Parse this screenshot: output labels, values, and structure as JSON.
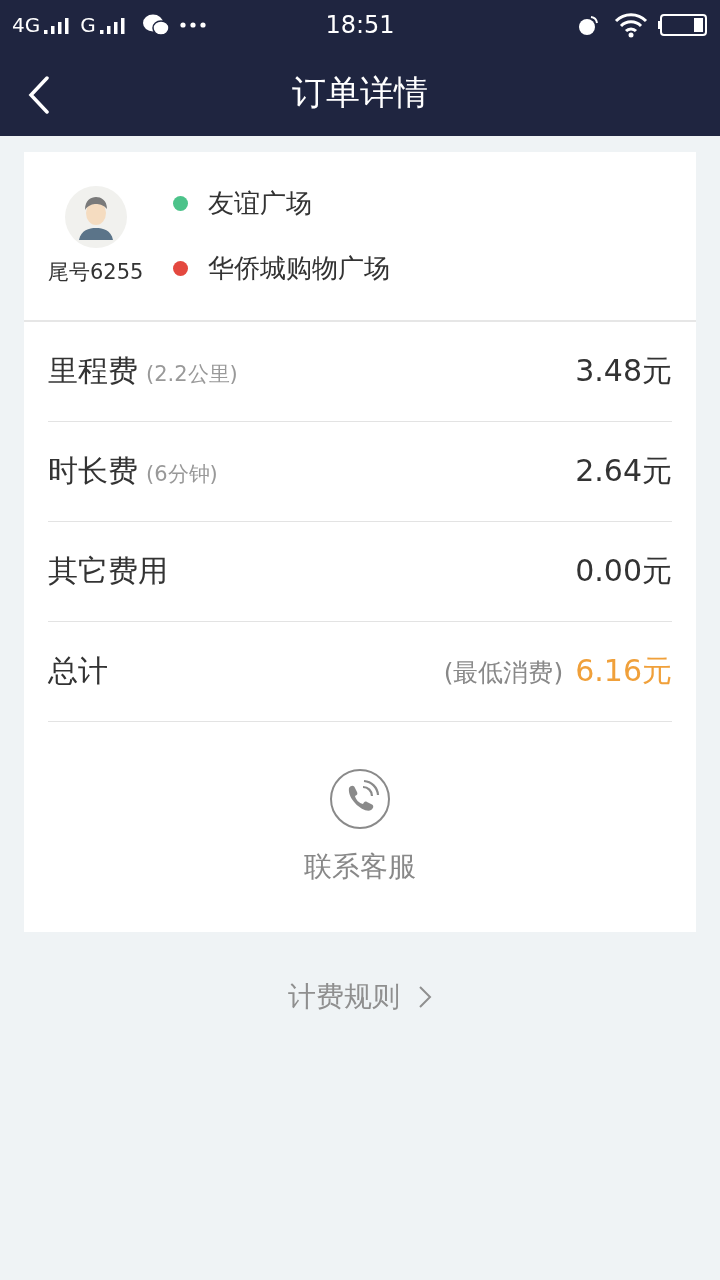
{
  "status_bar": {
    "network_1": "4G",
    "network_2": "G",
    "time": "18:51"
  },
  "nav": {
    "title": "订单详情"
  },
  "trip": {
    "driver_label": "尾号6255",
    "stops": [
      {
        "name": "友谊广场",
        "color": "#4cc38a"
      },
      {
        "name": "华侨城购物广场",
        "color": "#e4483f"
      }
    ]
  },
  "fees": [
    {
      "kind": "item",
      "label": "里程费",
      "note": "(2.2公里)",
      "amount": "3.48元"
    },
    {
      "kind": "item",
      "label": "时长费",
      "note": "(6分钟)",
      "amount": "2.64元"
    },
    {
      "kind": "item",
      "label": "其它费用",
      "amount": "0.00元"
    },
    {
      "kind": "total",
      "label": "总计",
      "note": "(最低消费)",
      "amount": "6.16元"
    }
  ],
  "contact": {
    "label": "联系客服"
  },
  "rules_link": {
    "label": "计费规则"
  }
}
